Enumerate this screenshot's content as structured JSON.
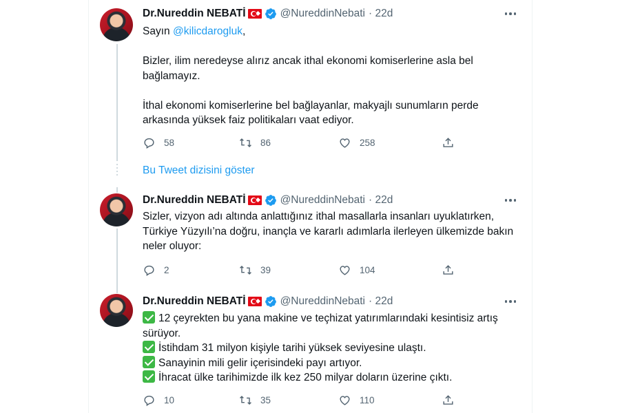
{
  "tweets": [
    {
      "name": "Dr.Nureddin NEBATİ",
      "handle": "@NureddinNebati",
      "time": "· 22d",
      "text": {
        "l1_pre": "Sayın ",
        "l1_mention": "@kilicdarogluk",
        "l1_post": ",",
        "p2": "Bizler, ilim neredeyse alırız ancak ithal ekonomi komiserlerine asla bel bağlamayız.",
        "p3": "İthal ekonomi komiserlerine bel bağlayanlar, makyajlı sunumların perde arkasında yüksek faiz politikaları vaat ediyor."
      },
      "replies": "58",
      "retweets": "86",
      "likes": "258"
    },
    {
      "name": "Dr.Nureddin NEBATİ",
      "handle": "@NureddinNebati",
      "time": "· 22d",
      "text": {
        "p1": "Sizler, vizyon adı altında anlattığınız ithal masallarla insanları uyuklatırken, Türkiye Yüzyılı’na doğru, inançla ve kararlı adımlarla ilerleyen ülkemizde bakın neler oluyor:"
      },
      "replies": "2",
      "retweets": "39",
      "likes": "104"
    },
    {
      "name": "Dr.Nureddin NEBATİ",
      "handle": "@NureddinNebati",
      "time": "· 22d",
      "text": {
        "b1": "12 çeyrekten bu yana makine ve teçhizat yatırımlarındaki kesintisiz artış sürüyor.",
        "b2": "İstihdam 31 milyon kişiyle tarihi yüksek seviyesine ulaştı.",
        "b3": "Sanayinin mili gelir içerisindeki payı artıyor.",
        "b4": "İhracat ülke tarihimizde ilk kez 250 milyar doların üzerine çıktı."
      },
      "replies": "10",
      "retweets": "35",
      "likes": "110"
    }
  ],
  "show_thread": "Bu Tweet dizisini göster",
  "icons": [
    "reply-icon",
    "retweet-icon",
    "like-icon",
    "share-icon",
    "verified-icon",
    "more-icon",
    "check-mark-icon",
    "turkey-flag-icon"
  ],
  "colors": {
    "accent": "#1d9bf0",
    "muted": "#536471",
    "check": "#3db845",
    "flag": "#e30a17"
  }
}
